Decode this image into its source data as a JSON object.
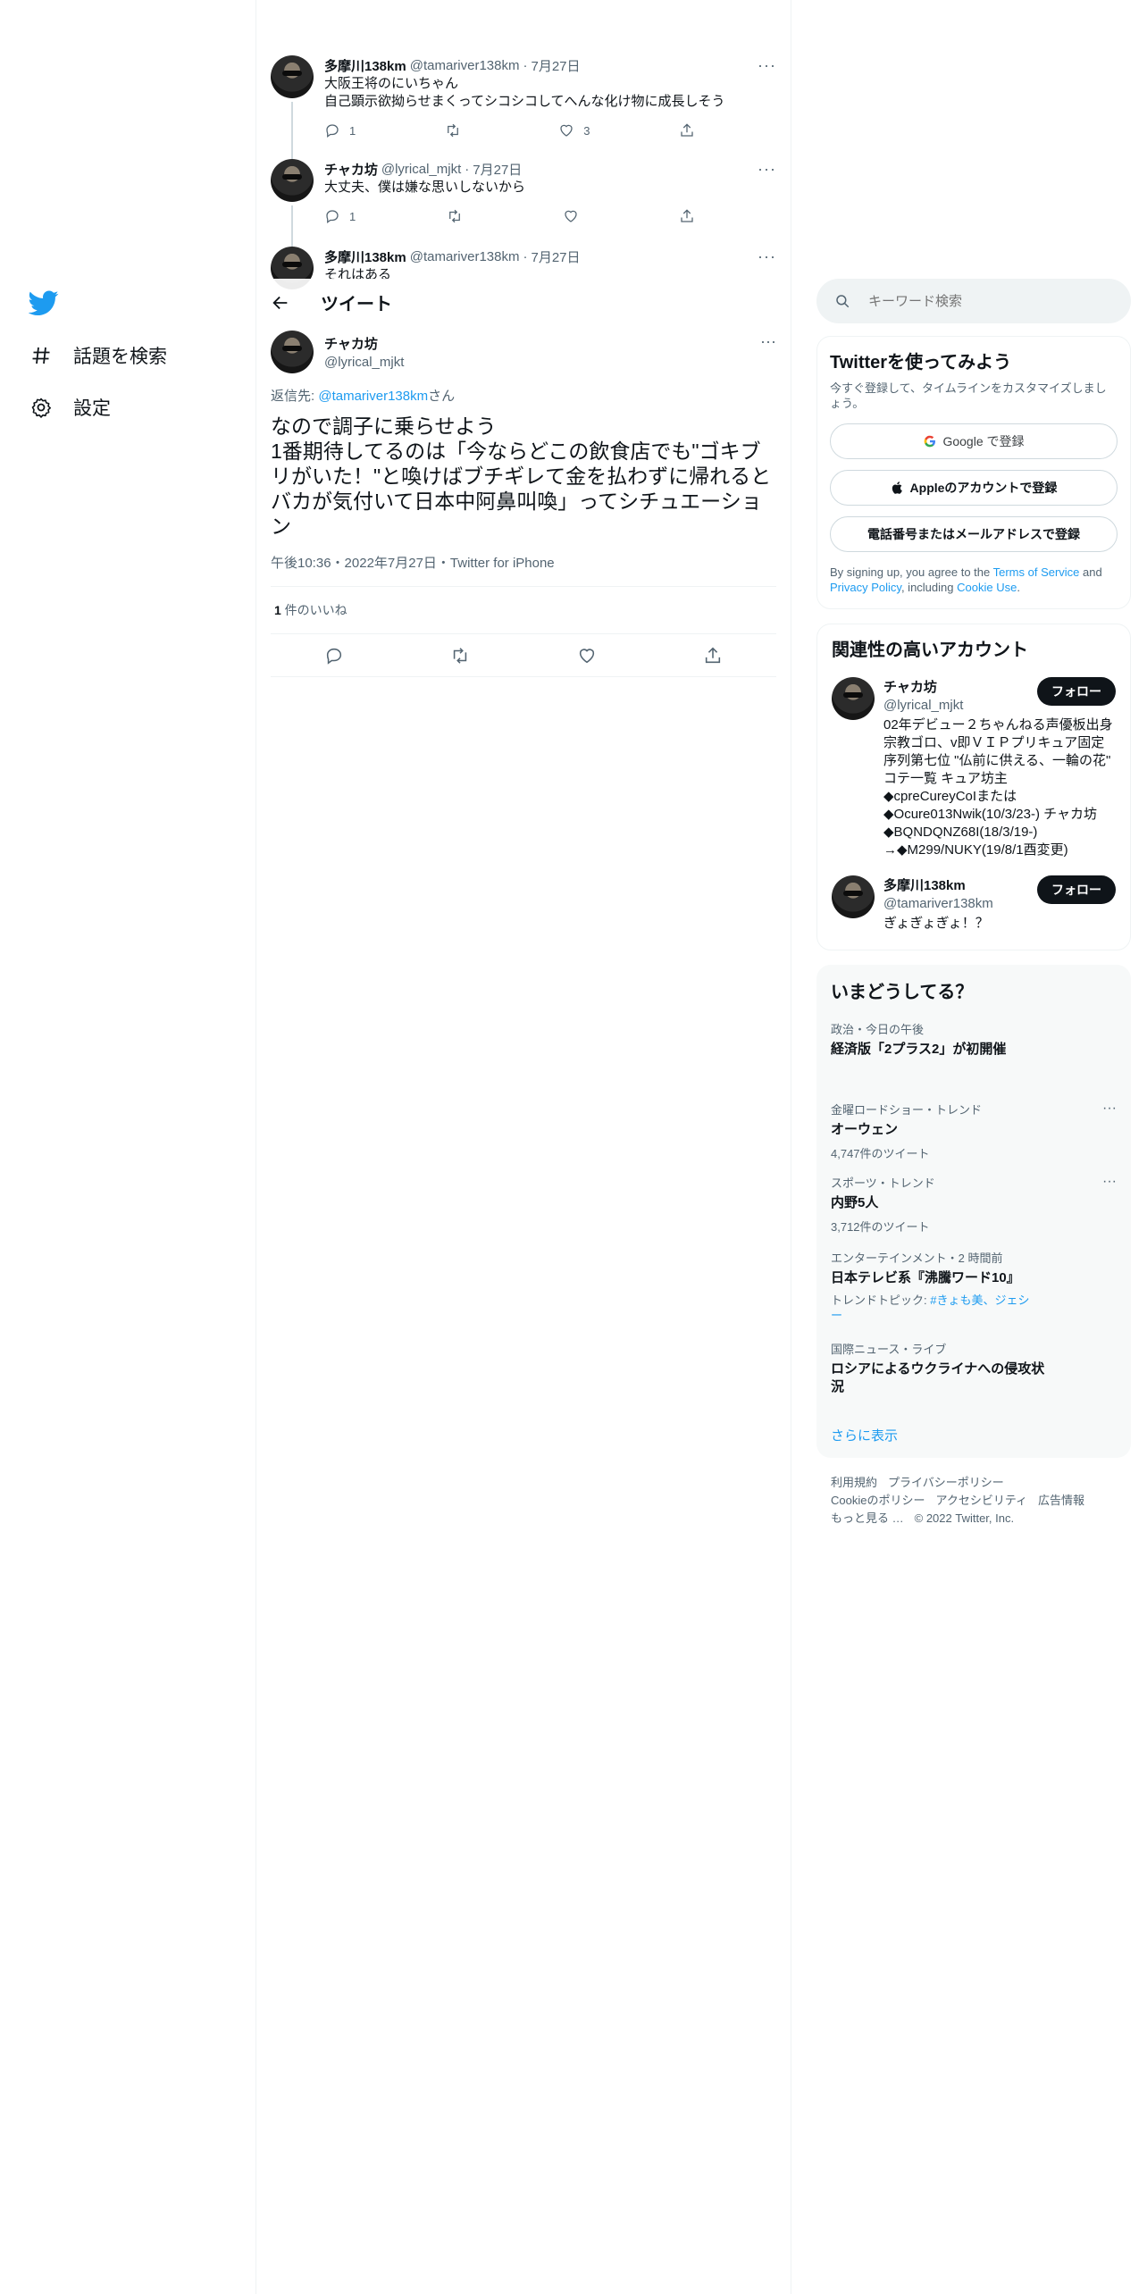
{
  "nav": {
    "items": [
      {
        "label": "話題を検索"
      },
      {
        "label": "設定"
      }
    ]
  },
  "thread": [
    {
      "name": "多摩川138km",
      "handle": "@tamariver138km",
      "date": "7月27日",
      "text": "大阪王将のにいちゃん\n自己顕示欲拗らせまくってシコシコしてへんな化け物に成長しそう",
      "replies": "1",
      "retweets": "",
      "likes": "3"
    },
    {
      "name": "チャカ坊",
      "handle": "@lyrical_mjkt",
      "date": "7月27日",
      "text": "大丈夫、僕は嫌な思いしないから",
      "replies": "1",
      "retweets": "",
      "likes": ""
    },
    {
      "name": "多摩川138km",
      "handle": "@tamariver138km",
      "date": "7月27日",
      "text": "それはある",
      "replies": "",
      "retweets": "",
      "likes": ""
    }
  ],
  "header": {
    "title": "ツイート"
  },
  "main_tweet": {
    "name": "チャカ坊",
    "handle": "@lyrical_mjkt",
    "reply_prefix": "返信先: ",
    "reply_target": "@tamariver138km",
    "reply_suffix": "さん",
    "text": "なので調子に乗らせよう\n1番期待してるのは「今ならどこの飲食店でも\"ゴキブリがいた！\"と喚けばブチギレて金を払わずに帰れるとバカが気付いて日本中阿鼻叫喚」ってシチュエーション",
    "meta": "午後10:36・2022年7月27日・Twitter for iPhone",
    "likes_count": "1",
    "likes_label": " 件のいいね"
  },
  "search": {
    "placeholder": "キーワード検索"
  },
  "signup": {
    "title": "Twitterを使ってみよう",
    "subtitle": "今すぐ登録して、タイムラインをカスタマイズしましょう。",
    "google": "Google で登録",
    "apple": "Appleのアカウントで登録",
    "phone": "電話番号またはメールアドレスで登録",
    "tos_1": "By signing up, you agree to the ",
    "tos_link1": "Terms of Service",
    "tos_2": " and ",
    "tos_link2": "Privacy Policy",
    "tos_3": ", including ",
    "tos_link3": "Cookie Use",
    "tos_4": "."
  },
  "related": {
    "title": "関連性の高いアカウント",
    "accounts": [
      {
        "name": "チャカ坊",
        "handle": "@lyrical_mjkt",
        "follow": "フォロー",
        "bio": "02年デビュー２ちゃんねる声優板出身 宗教ゴロ、v即ＶＩＰプリキュア固定 序列第七位 \"仏前に供える、一輪の花\" コテ一覧 キュア坊主\n◆cpreCureyCoIまたは\n◆Ocure013Nwik(10/3/23-) チャカ坊\n◆BQNDQNZ68I(18/3/19-)\n→◆M299/NUKY(19/8/1酉変更)"
      },
      {
        "name": "多摩川138km",
        "handle": "@tamariver138km",
        "follow": "フォロー",
        "bio": "ぎょぎょぎょ！？"
      }
    ]
  },
  "trends": {
    "title": "いまどうしてる？",
    "items": [
      {
        "meta": "政治・今日の午後",
        "title": "経済版「2プラス2」が初開催"
      },
      {
        "meta": "金曜ロードショー・トレンド",
        "title": "オーウェン",
        "count": "4,747件のツイート"
      },
      {
        "meta": "スポーツ・トレンド",
        "title": "内野5人",
        "count": "3,712件のツイート"
      },
      {
        "meta": "エンターテインメント・2 時間前",
        "title": "日本テレビ系『沸騰ワード10』",
        "topic_prefix": "トレンドトピック: ",
        "topic_links": "#きょも美、ジェシー"
      },
      {
        "meta": "国際ニュース・ライブ",
        "title": "ロシアによるウクライナへの侵攻状況"
      }
    ],
    "show_more": "さらに表示"
  },
  "footer": {
    "links": [
      "利用規約",
      "プライバシーポリシー",
      "Cookieのポリシー",
      "アクセシビリティ",
      "広告情報",
      "もっと見る …",
      "© 2022 Twitter, Inc."
    ]
  },
  "colors": {
    "accent": "#1d9bf0",
    "text": "#0f1419",
    "muted": "#536471",
    "border": "#eff3f4"
  }
}
